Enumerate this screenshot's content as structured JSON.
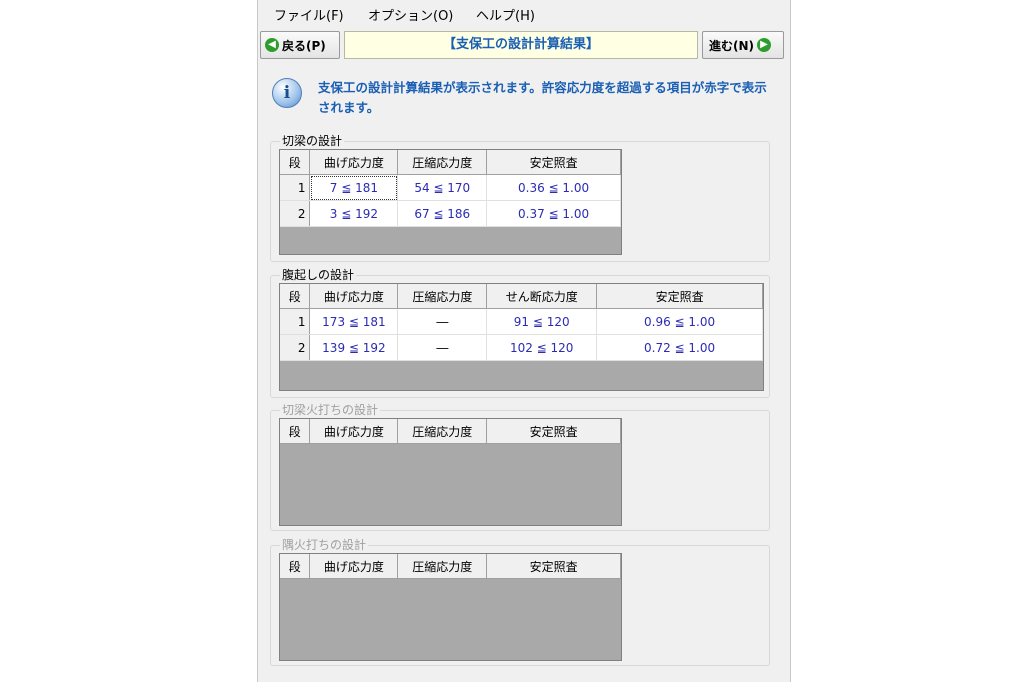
{
  "menu": [
    "ファイル(F)",
    "オプション(O)",
    "ヘルプ(H)"
  ],
  "nav": {
    "back_label": "戻る(P)",
    "title": "【支保工の設計計算結果】",
    "next_label": "進む(N)"
  },
  "info": {
    "icon": "info-icon",
    "text": "支保工の設計計算結果が表示されます。許容応力度を超過する項目が赤字で表示されます。"
  },
  "sections": [
    {
      "title": "切梁の設計",
      "disabled": false,
      "headers": [
        "段",
        "曲げ応力度",
        "圧縮応力度",
        "安定照査"
      ],
      "rows": [
        [
          "1",
          "7 ≦ 181",
          "54 ≦ 170",
          "0.36 ≦  1.00"
        ],
        [
          "2",
          "3 ≦ 192",
          "67 ≦ 186",
          "0.37 ≦  1.00"
        ]
      ]
    },
    {
      "title": "腹起しの設計",
      "disabled": false,
      "headers": [
        "段",
        "曲げ応力度",
        "圧縮応力度",
        "せん断応力度",
        "安定照査"
      ],
      "rows": [
        [
          "1",
          "173 ≦ 181",
          "―",
          "91 ≦ 120",
          "0.96 ≦  1.00"
        ],
        [
          "2",
          "139 ≦ 192",
          "―",
          "102 ≦ 120",
          "0.72 ≦  1.00"
        ]
      ]
    },
    {
      "title": "切梁火打ちの設計",
      "disabled": true,
      "headers": [
        "段",
        "曲げ応力度",
        "圧縮応力度",
        "安定照査"
      ],
      "rows": []
    },
    {
      "title": "隅火打ちの設計",
      "disabled": true,
      "headers": [
        "段",
        "曲げ応力度",
        "圧縮応力度",
        "安定照査"
      ],
      "rows": []
    }
  ],
  "colors": {
    "accent": "#1a5fb4",
    "value": "#2b2bb5",
    "title_bg": "#ffffe3"
  }
}
